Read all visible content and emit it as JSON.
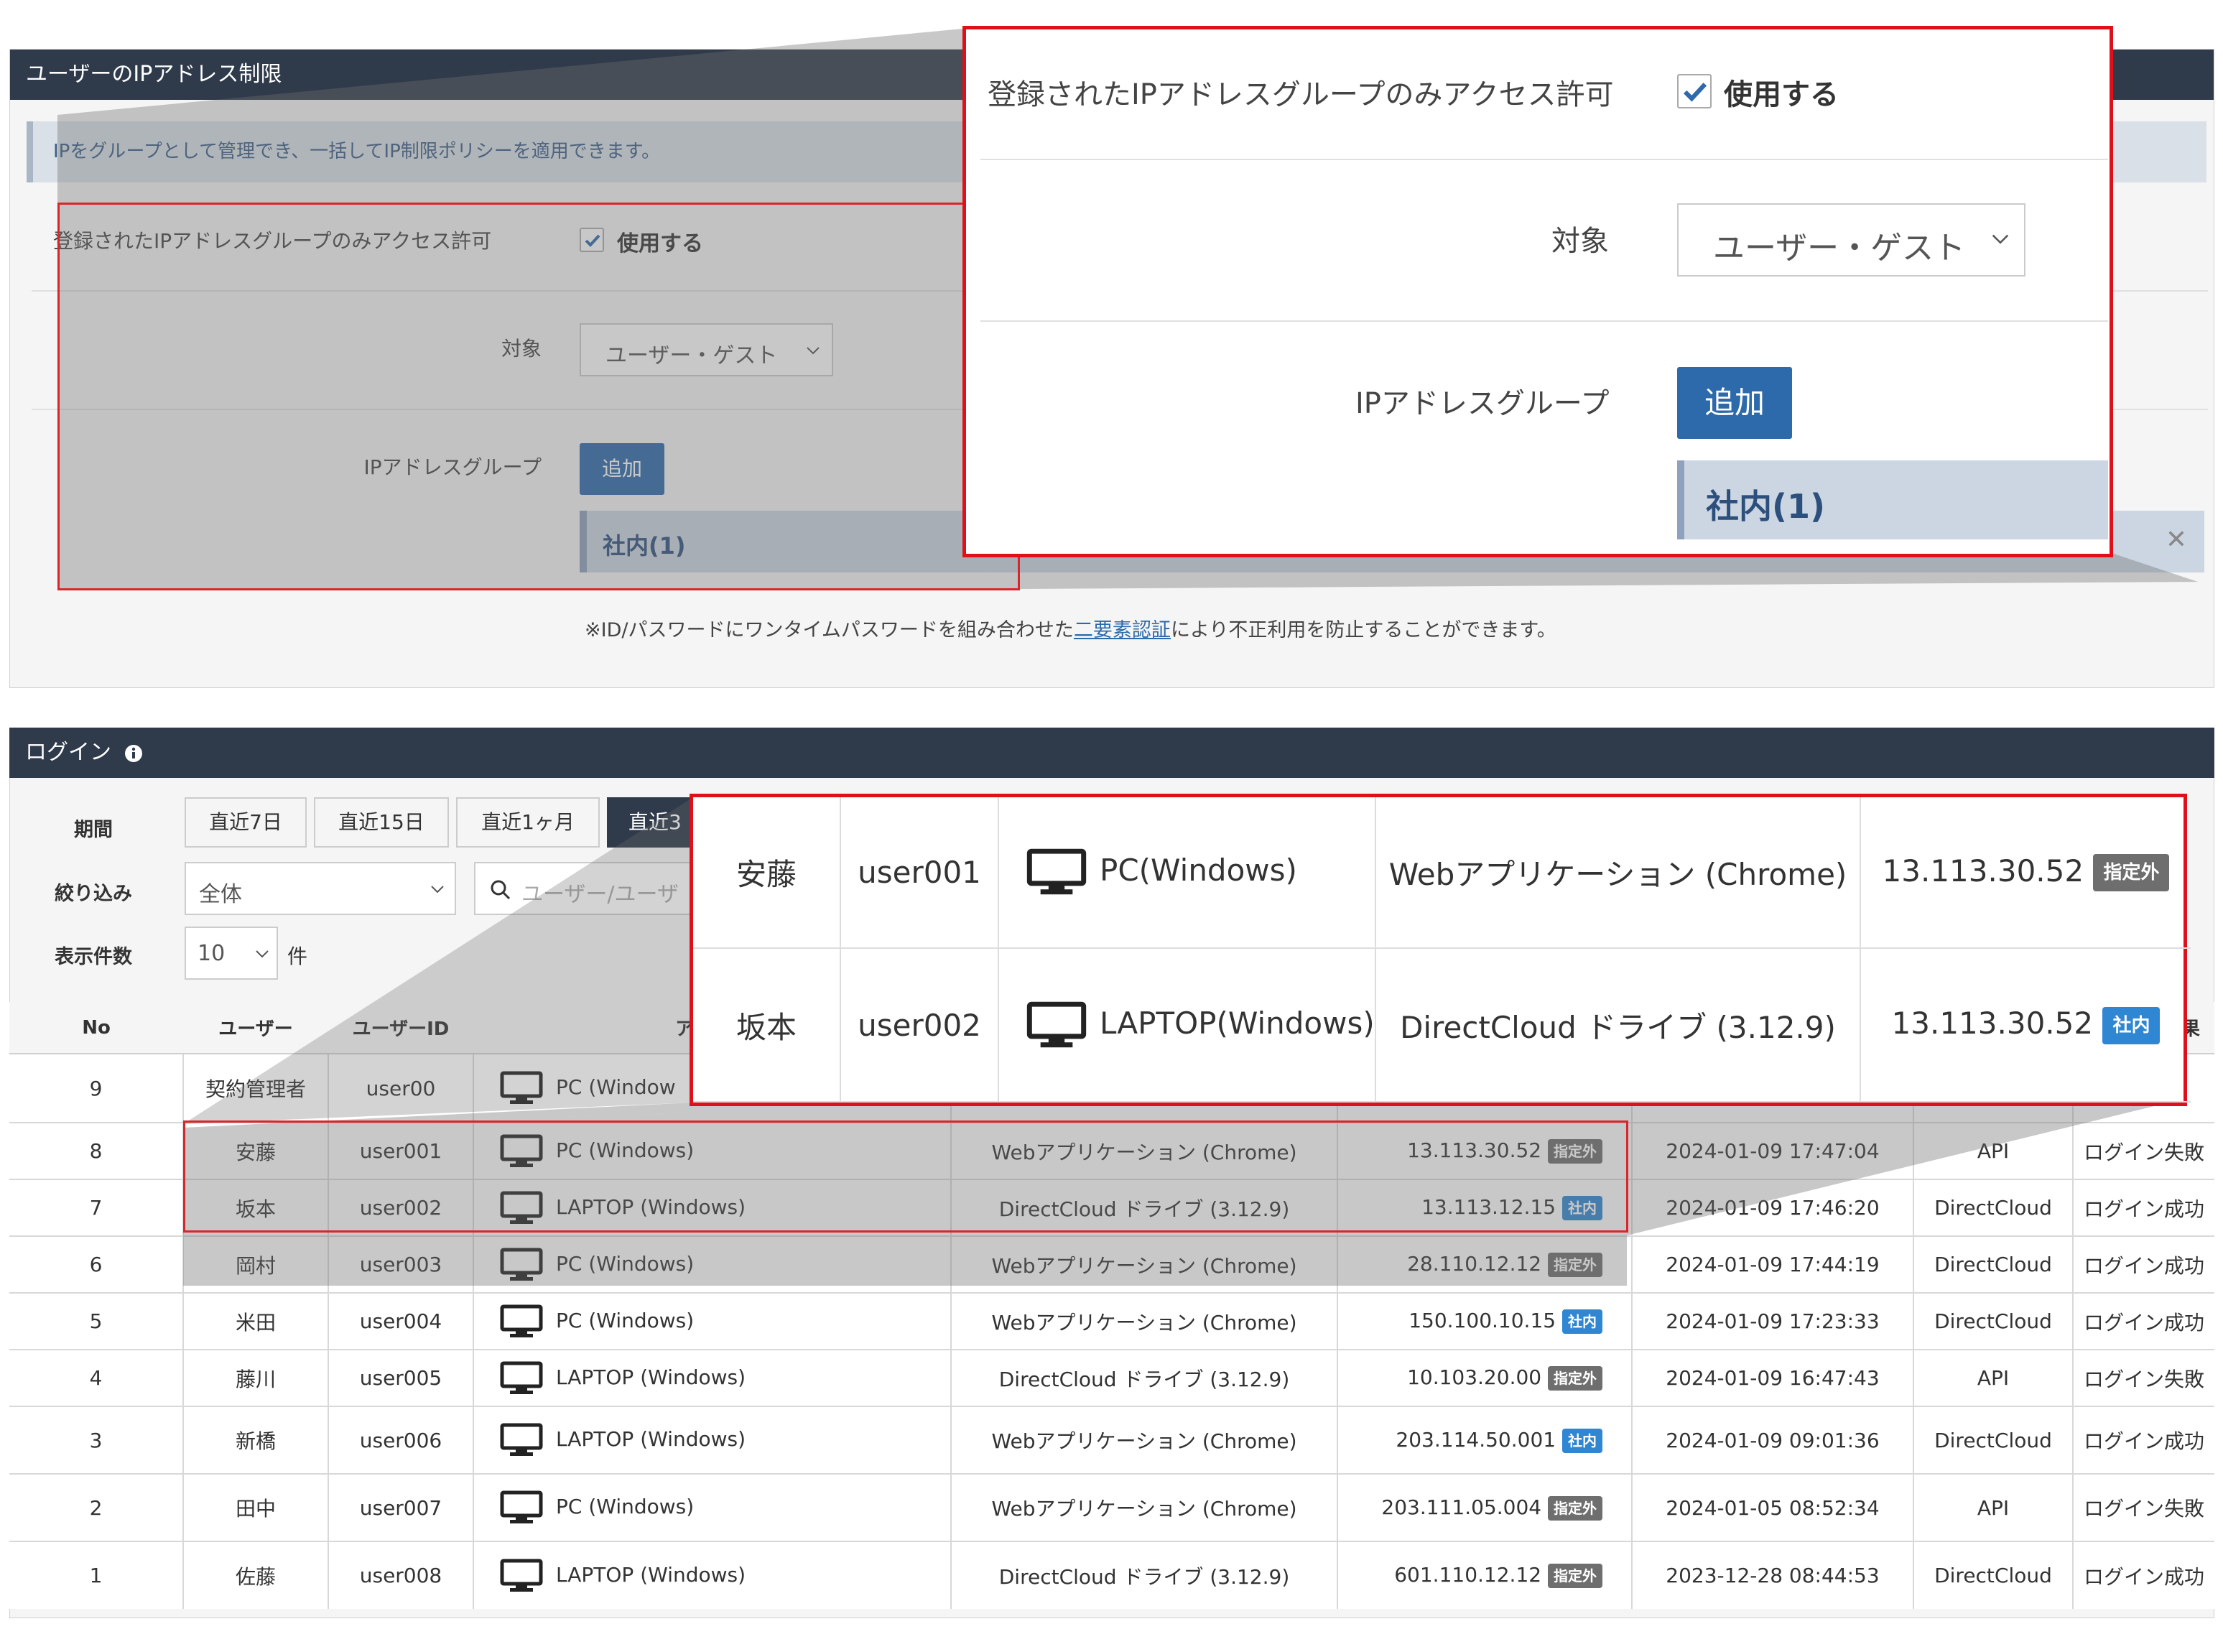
{
  "ip_panel": {
    "title": "ユーザーのIPアドレス制限",
    "info": "IPをグループとして管理でき、一括してIP制限ポリシーを適用できます。",
    "allow_label": "登録されたIPアドレスグループのみアクセス許可",
    "use_label": "使用する",
    "target_label": "対象",
    "target_value": "ユーザー・ゲスト",
    "group_label": "IPアドレスグループ",
    "add_label": "追加",
    "group_item": "社内(1)",
    "remove_glyph": "✕",
    "note_prefix": "※ID/パスワードにワンタイムパスワードを組み合わせた",
    "note_link": "二要素認証",
    "note_suffix": "により不正利用を防止することができます。"
  },
  "login_panel": {
    "title": "ログイン",
    "period_label": "期間",
    "period_buttons": [
      "直近7日",
      "直近15日",
      "直近1ヶ月",
      "直近3"
    ],
    "filter_label": "絞り込み",
    "filter_value": "全体",
    "search_placeholder": "ユーザー/ユーザ",
    "count_label": "表示件数",
    "count_value": "10",
    "count_unit": "件",
    "columns": [
      "No",
      "ユーザー",
      "ユーザーID",
      "アクセス",
      "",
      "",
      "",
      "",
      "果"
    ],
    "rows": [
      {
        "no": "9",
        "user": "契約管理者",
        "id": "user00",
        "device": "PC (Window",
        "app": "",
        "ip": "",
        "tag": "",
        "time": "",
        "via": "",
        "result": "功"
      },
      {
        "no": "8",
        "user": "安藤",
        "id": "user001",
        "device": "PC (Windows)",
        "app": "Webアプリケーション (Chrome)",
        "ip": "13.113.30.52",
        "tag": "指定外",
        "time": "2024-01-09 17:47:04",
        "via": "API",
        "result": "ログイン失敗"
      },
      {
        "no": "7",
        "user": "坂本",
        "id": "user002",
        "device": "LAPTOP (Windows)",
        "app": "DirectCloud ドライブ (3.12.9)",
        "ip": "13.113.12.15",
        "tag": "社内",
        "time": "2024-01-09 17:46:20",
        "via": "DirectCloud",
        "result": "ログイン成功"
      },
      {
        "no": "6",
        "user": "岡村",
        "id": "user003",
        "device": "PC (Windows)",
        "app": "Webアプリケーション (Chrome)",
        "ip": "28.110.12.12",
        "tag": "指定外",
        "time": "2024-01-09 17:44:19",
        "via": "DirectCloud",
        "result": "ログイン成功"
      },
      {
        "no": "5",
        "user": "米田",
        "id": "user004",
        "device": "PC (Windows)",
        "app": "Webアプリケーション (Chrome)",
        "ip": "150.100.10.15",
        "tag": "社内",
        "time": "2024-01-09 17:23:33",
        "via": "DirectCloud",
        "result": "ログイン成功"
      },
      {
        "no": "4",
        "user": "藤川",
        "id": "user005",
        "device": "LAPTOP (Windows)",
        "app": "DirectCloud ドライブ (3.12.9)",
        "ip": "10.103.20.00",
        "tag": "指定外",
        "time": "2024-01-09 16:47:43",
        "via": "API",
        "result": "ログイン失敗"
      },
      {
        "no": "3",
        "user": "新橋",
        "id": "user006",
        "device": "LAPTOP (Windows)",
        "app": "Webアプリケーション (Chrome)",
        "ip": "203.114.50.001",
        "tag": "社内",
        "time": "2024-01-09 09:01:36",
        "via": "DirectCloud",
        "result": "ログイン成功"
      },
      {
        "no": "2",
        "user": "田中",
        "id": "user007",
        "device": "PC (Windows)",
        "app": "Webアプリケーション (Chrome)",
        "ip": "203.111.05.004",
        "tag": "指定外",
        "time": "2024-01-05 08:52:34",
        "via": "API",
        "result": "ログイン失敗"
      },
      {
        "no": "1",
        "user": "佐藤",
        "id": "user008",
        "device": "LAPTOP (Windows)",
        "app": "DirectCloud ドライブ (3.12.9)",
        "ip": "601.110.12.12",
        "tag": "指定外",
        "time": "2023-12-28 08:44:53",
        "via": "DirectCloud",
        "result": "ログイン成功"
      }
    ]
  },
  "zoom_rows": [
    {
      "user": "安藤",
      "id": "user001",
      "device": "PC(Windows)",
      "app": "Webアプリケーション (Chrome)",
      "ip": "13.113.30.52",
      "tag": "指定外"
    },
    {
      "user": "坂本",
      "id": "user002",
      "device": "LAPTOP(Windows)",
      "app": "DirectCloud ドライブ (3.12.9)",
      "ip": "13.113.30.52",
      "tag": "社内"
    }
  ],
  "colors": {
    "header": "#2f3a4b",
    "accent": "#2d6aab",
    "highlight": "#e0101a",
    "tag_internal": "#2f86d3",
    "tag_external": "#6e6e6e"
  }
}
